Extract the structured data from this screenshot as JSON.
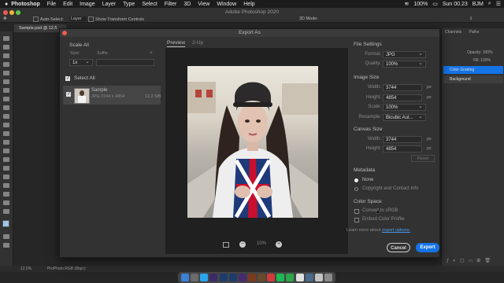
{
  "menubar": {
    "apple": "",
    "items": [
      "Photoshop",
      "File",
      "Edit",
      "Image",
      "Layer",
      "Type",
      "Select",
      "Filter",
      "3D",
      "View",
      "Window",
      "Help"
    ],
    "battery": "100%",
    "clock": "Sun 00.23",
    "user": "BJM"
  },
  "optionsbar": {
    "title": "Adobe Photoshop 2020",
    "auto_select": "Auto-Select:",
    "auto_select_value": "Layer",
    "transform_controls": "Show Transform Controls",
    "mode_3d": "3D Mode:"
  },
  "document_tab": "Sample.psd @ 12.5",
  "status": {
    "zoom": "12.5%",
    "profile": "ProPhoto RGB (8bpc)"
  },
  "right_panel": {
    "tabs": [
      "Channels",
      "Paths"
    ],
    "opacity_label": "Opacity:",
    "opacity_value": "100%",
    "fill_label": "Fill:",
    "fill_value": "100%",
    "layers": [
      "Color Grading",
      "Background"
    ]
  },
  "dialog": {
    "title": "Export As",
    "scale_all": "Scale All",
    "size_label": "Size:",
    "suffix_label": "Suffix:",
    "add": "+",
    "scale_value": "1x",
    "select_all": "Select All",
    "asset": {
      "name": "Sample",
      "format": "JPG",
      "dims": "3744 x 4854",
      "size": "12.2 MB"
    },
    "preview_tabs": [
      "Preview",
      "2-Up"
    ],
    "zoom": "10%",
    "file_settings": {
      "heading": "File Settings",
      "format_label": "Format:",
      "format_value": "JPG",
      "quality_label": "Quality:",
      "quality_value": "100%"
    },
    "image_size": {
      "heading": "Image Size",
      "width_label": "Width:",
      "width_value": "3744",
      "width_unit": "px",
      "height_label": "Height:",
      "height_value": "4854",
      "height_unit": "px",
      "scale_label": "Scale:",
      "scale_value": "100%",
      "resample_label": "Resample:",
      "resample_value": "Bicubic Aut..."
    },
    "canvas_size": {
      "heading": "Canvas Size",
      "width_label": "Width:",
      "width_value": "3744",
      "width_unit": "px",
      "height_label": "Height:",
      "height_value": "4854",
      "height_unit": "px",
      "reset": "Reset"
    },
    "metadata": {
      "heading": "Metadata",
      "none": "None",
      "copyright": "Copyright and Contact Info"
    },
    "color_space": {
      "heading": "Color Space",
      "convert": "Convert to sRGB",
      "embed": "Embed Color Profile"
    },
    "learn_more": "Learn more about",
    "export_options": "export options.",
    "cancel": "Cancel",
    "export": "Export"
  },
  "colors": {
    "accent": "#1473e6",
    "layer_selected": "#1473e6"
  }
}
